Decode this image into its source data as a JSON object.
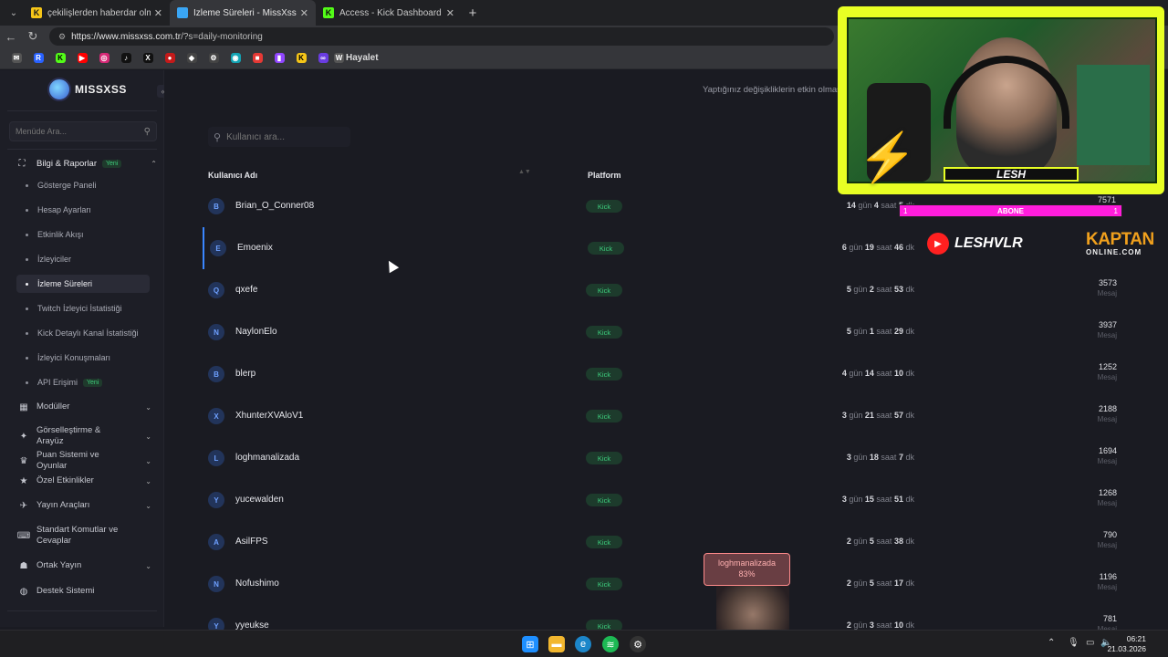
{
  "browser": {
    "tabs": [
      {
        "label": "çekilişlerden haberdar olmak için",
        "favicon": "K",
        "favcolor": "#1a1a1a",
        "favbg": "#f5c518",
        "active": false
      },
      {
        "label": "İzleme Süreleri - MissXss AI Bot Sy",
        "favicon": "",
        "favcolor": "#fff",
        "favbg": "#3aa6f5",
        "active": true
      },
      {
        "label": "Access - Kick Dashboard",
        "favicon": "K",
        "favcolor": "#0c0c0c",
        "favbg": "#53fc18",
        "active": false
      }
    ],
    "url_host": "https://www.missxss.com.tr",
    "url_path": "/?s=daily-monitoring",
    "bookmark_label": "Hayalet"
  },
  "sidebar": {
    "logo_text": "MISSXSS",
    "search_placeholder": "Menüde Ara...",
    "section_title": "Bilgi & Raporlar",
    "section_badge": "Yeni",
    "sub_items": [
      {
        "label": "Gösterge Paneli"
      },
      {
        "label": "Hesap Ayarları"
      },
      {
        "label": "Etkinlik Akışı"
      },
      {
        "label": "İzleyiciler"
      },
      {
        "label": "İzleme Süreleri"
      },
      {
        "label": "Twitch İzleyici İstatistiği"
      },
      {
        "label": "Kick Detaylı Kanal İstatistiği"
      },
      {
        "label": "İzleyici Konuşmaları"
      },
      {
        "label": "API Erişimi",
        "badge": "Yeni"
      }
    ],
    "nav_items": [
      {
        "label": "Modüller"
      },
      {
        "label": "Görselleştirme & Arayüz"
      },
      {
        "label": "Puan Sistemi ve Oyunlar"
      },
      {
        "label": "Özel Etkinlikler"
      },
      {
        "label": "Yayın Araçları"
      },
      {
        "label": "Standart Komutlar ve Cevaplar"
      },
      {
        "label": "Ortak Yayın"
      },
      {
        "label": "Destek Sistemi"
      }
    ]
  },
  "main": {
    "notice": "Yaptığınız değişikliklerin etkin olması",
    "search_placeholder": "Kullanıcı ara...",
    "col_username": "Kullanıcı Adı",
    "col_platform": "Platform",
    "msg_label": "Mesaj",
    "top_partial_value": "7571",
    "rows": [
      {
        "initial": "B",
        "name": "Brian_O_Conner08",
        "platform": "Kick",
        "d": "14",
        "h": "4",
        "m": "5",
        "messages": "",
        "partial": true
      },
      {
        "initial": "E",
        "name": "Emoenix",
        "platform": "Kick",
        "d": "6",
        "h": "19",
        "m": "46",
        "messages": "",
        "selected": true
      },
      {
        "initial": "Q",
        "name": "qxefe",
        "platform": "Kick",
        "d": "5",
        "h": "2",
        "m": "53",
        "messages": "3573"
      },
      {
        "initial": "N",
        "name": "NaylonElo",
        "platform": "Kick",
        "d": "5",
        "h": "1",
        "m": "29",
        "messages": "3937"
      },
      {
        "initial": "B",
        "name": "blerp",
        "platform": "Kick",
        "d": "4",
        "h": "14",
        "m": "10",
        "messages": "1252"
      },
      {
        "initial": "X",
        "name": "XhunterXVAloV1",
        "platform": "Kick",
        "d": "3",
        "h": "21",
        "m": "57",
        "messages": "2188"
      },
      {
        "initial": "L",
        "name": "loghmanalizada",
        "platform": "Kick",
        "d": "3",
        "h": "18",
        "m": "7",
        "messages": "1694"
      },
      {
        "initial": "Y",
        "name": "yucewalden",
        "platform": "Kick",
        "d": "3",
        "h": "15",
        "m": "51",
        "messages": "1268"
      },
      {
        "initial": "A",
        "name": "AsilFPS",
        "platform": "Kick",
        "d": "2",
        "h": "5",
        "m": "38",
        "messages": "790"
      },
      {
        "initial": "N",
        "name": "Nofushimo",
        "platform": "Kick",
        "d": "2",
        "h": "5",
        "m": "17",
        "messages": "1196"
      },
      {
        "initial": "Y",
        "name": "yyeukse",
        "platform": "Kick",
        "d": "2",
        "h": "3",
        "m": "10",
        "messages": "781"
      }
    ],
    "unit_day": "gün",
    "unit_hour": "saat",
    "unit_min": "dk"
  },
  "overlay": {
    "nameplate": "LESH",
    "subbar_left": "1",
    "subbar_mid": "ABONE",
    "subbar_right": "1",
    "yt_handle": "LESHVLR",
    "kaptan_main": "KAPTAN",
    "kaptan_sub": "ONLINE.COM",
    "alert_text_1": "loghmanalizada",
    "alert_text_2": "83%"
  },
  "taskbar": {
    "time": "06:21",
    "date": "21.03.2026"
  }
}
